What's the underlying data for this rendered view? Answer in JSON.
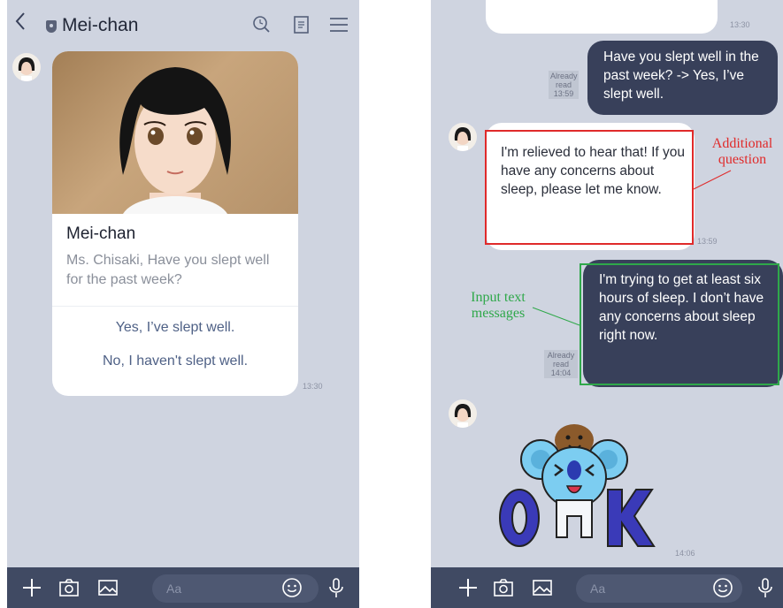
{
  "left": {
    "header": {
      "title": "Mei-chan"
    },
    "card": {
      "name": "Mei-chan",
      "question": "Ms. Chisaki, Have you slept well for the past week?",
      "options": [
        "Yes, I’ve slept well.",
        "No, I haven't slept well."
      ],
      "time": "13:30"
    },
    "input_placeholder": "Aa"
  },
  "right": {
    "top_time": "13:30",
    "user_msg_1": "Have you slept well in the past week? -> Yes, I’ve slept well.",
    "read_1": {
      "line1": "Already",
      "line2": "read",
      "time": "13:59"
    },
    "bot_msg": "I'm relieved to hear that! If you have any concerns about sleep, please let me know.",
    "bot_time": "13:59",
    "user_msg_2": "I'm trying to get at least six hours of sleep. I don’t have any concerns about sleep right now.",
    "read_2": {
      "line1": "Already",
      "line2": "read",
      "time": "14:04"
    },
    "sticker_time": "14:06",
    "input_placeholder": "Aa"
  },
  "annotations": {
    "additional_question": "Additional question",
    "input_text_messages": "Input text messages"
  },
  "colors": {
    "background": "#cfd4e0",
    "outgoing_bubble": "#38405a",
    "toolbar": "#404a63",
    "annotation_red": "#e02a2a",
    "annotation_green": "#2fa84a"
  }
}
